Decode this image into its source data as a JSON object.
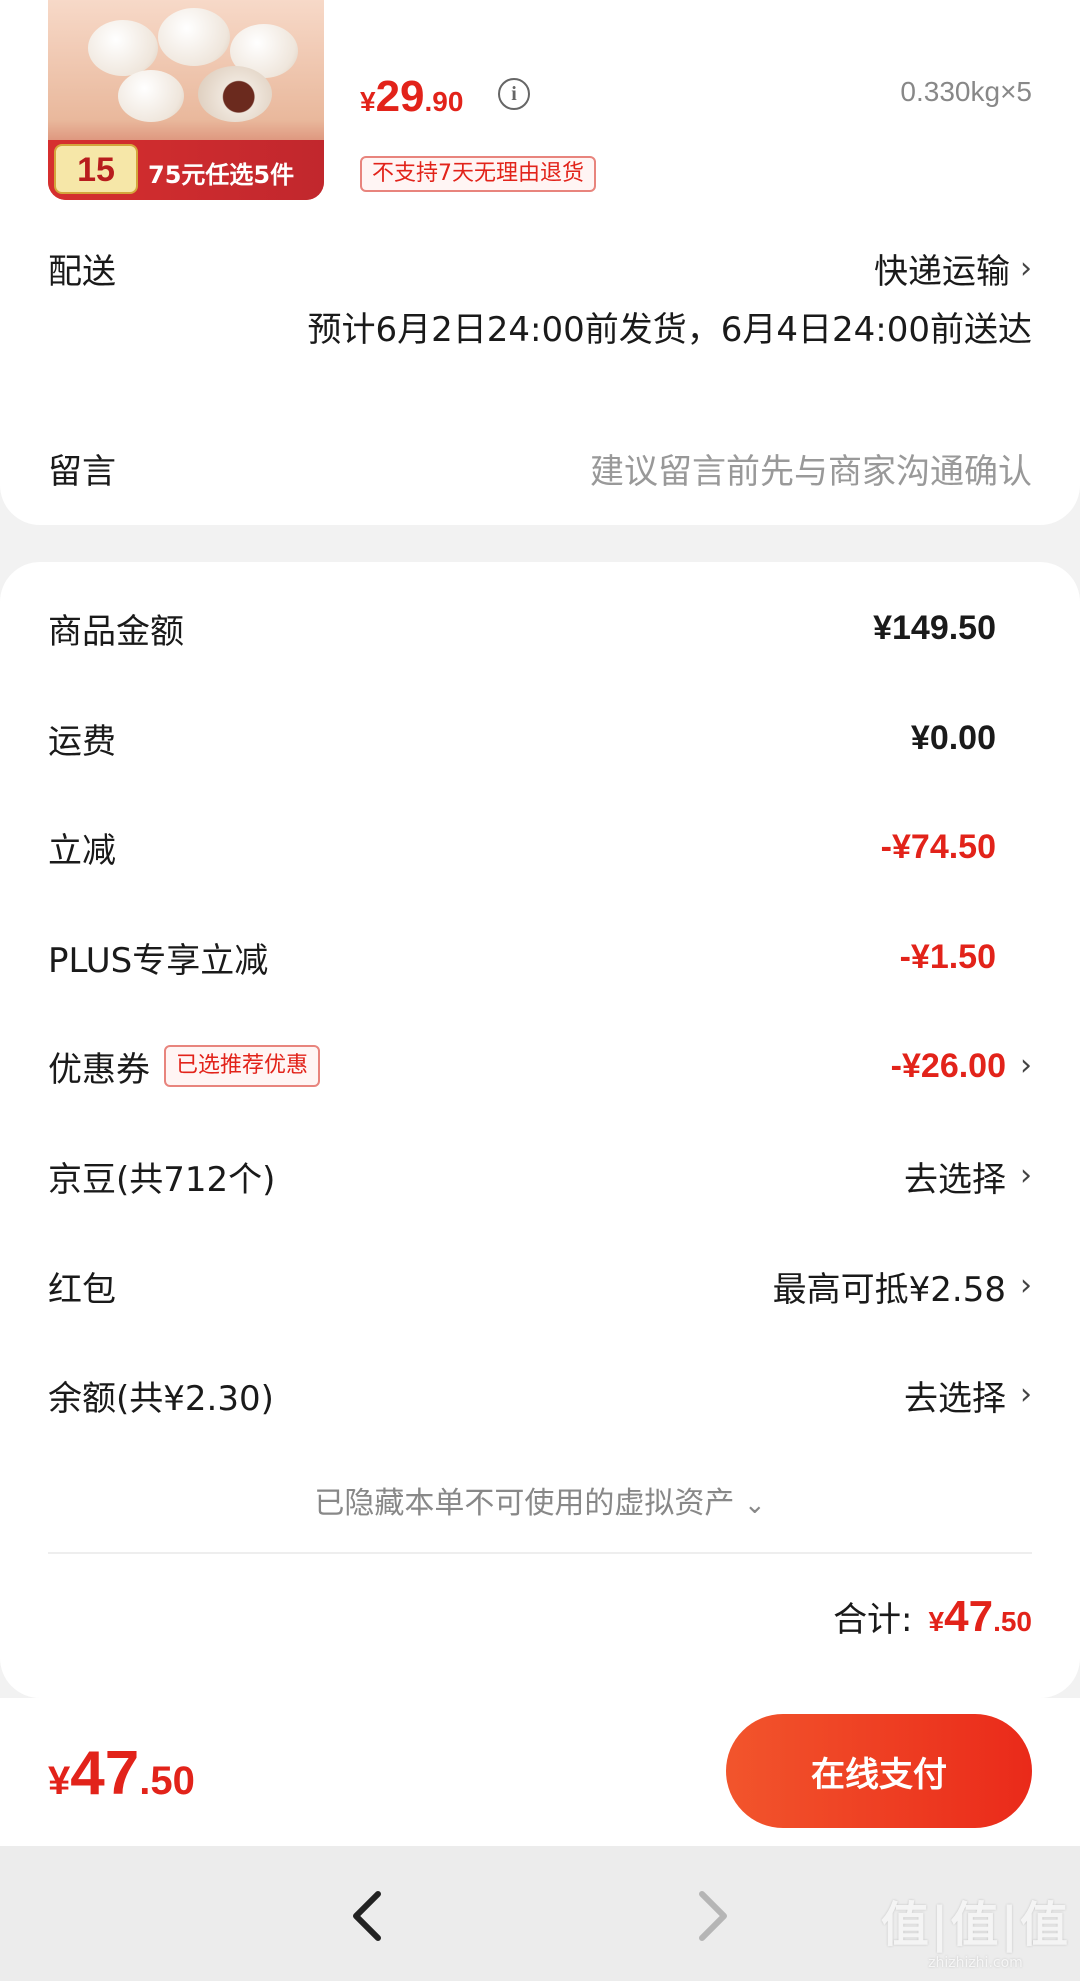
{
  "product": {
    "thumb_price": "15",
    "thumb_promo": "75元任选5件",
    "price_symbol": "¥",
    "price_int": "29",
    "price_dec": ".90",
    "spec": "0.330kg×5",
    "return_policy": "不支持7天无理由退货"
  },
  "delivery": {
    "label": "配送",
    "method": "快递运输",
    "eta": "预计6月2日24:00前发货，6月4日24:00前送达"
  },
  "message": {
    "label": "留言",
    "placeholder": "建议留言前先与商家沟通确认"
  },
  "amounts": [
    {
      "label": "商品金额",
      "value": "¥149.50"
    },
    {
      "label": "运费",
      "value": "¥0.00"
    },
    {
      "label": "立减",
      "value": "-¥74.50"
    },
    {
      "label": "PLUS专享立减",
      "value": "-¥1.50"
    },
    {
      "label": "优惠券",
      "tag": "已选推荐优惠",
      "value": "-¥26.00"
    },
    {
      "label": "京豆(共712个)",
      "value": "去选择"
    },
    {
      "label": "红包",
      "value": "最高可抵¥2.58"
    },
    {
      "label": "余额(共¥2.30)",
      "value": "去选择"
    }
  ],
  "hidden_assets": "已隐藏本单不可使用的虚拟资产",
  "total": {
    "label": "合计:",
    "symbol": "¥",
    "int": "47",
    "dec": ".50"
  },
  "paybar": {
    "symbol": "¥",
    "int": "47",
    "dec": ".50",
    "button_label": "在线支付"
  },
  "watermark": {
    "main": "值|值|值",
    "sub": "zhizhizhi.com"
  },
  "colors": {
    "accent_red": "#e2231a",
    "pay_button_gradient": [
      "#f2552c",
      "#ea2a1a"
    ],
    "background": "#f2f2f2"
  }
}
